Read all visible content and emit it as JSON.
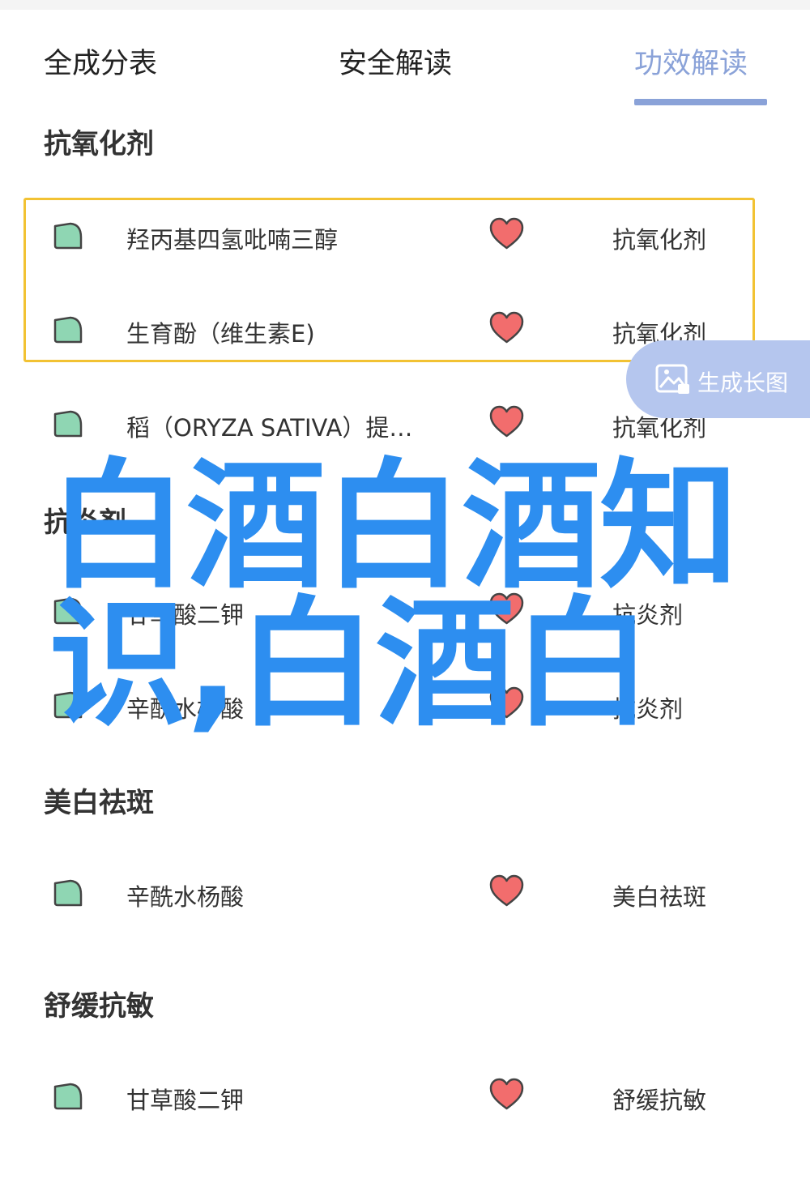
{
  "tabs": {
    "items": [
      "全成分表",
      "安全解读",
      "功效解读"
    ],
    "active_index": 2,
    "accent_color": "#8aa2d8"
  },
  "sections": [
    {
      "title": "抗氧化剂",
      "rows": [
        {
          "icon": "ingredient-leaf-icon",
          "name": "羟丙基四氢吡喃三醇",
          "rating_icon": "heart-icon",
          "effect": "抗氧化剂"
        },
        {
          "icon": "ingredient-leaf-icon",
          "name": "生育酚（维生素E)",
          "rating_icon": "heart-icon",
          "effect": "抗氧化剂"
        },
        {
          "icon": "ingredient-leaf-icon",
          "name": "稻（ORYZA SATIVA）提…",
          "rating_icon": "heart-icon",
          "effect": "抗氧化剂"
        }
      ]
    },
    {
      "title": "抗炎剂",
      "rows": [
        {
          "icon": "ingredient-leaf-icon",
          "name": "甘草酸二钾",
          "rating_icon": "heart-icon",
          "effect": "抗炎剂"
        },
        {
          "icon": "ingredient-leaf-icon",
          "name": "辛酰水杨酸",
          "rating_icon": "heart-icon",
          "effect": "抗炎剂"
        }
      ]
    },
    {
      "title": "美白祛斑",
      "rows": [
        {
          "icon": "ingredient-leaf-icon",
          "name": "辛酰水杨酸",
          "rating_icon": "heart-icon",
          "effect": "美白祛斑"
        }
      ]
    },
    {
      "title": "舒缓抗敏",
      "rows": [
        {
          "icon": "ingredient-leaf-icon",
          "name": "甘草酸二钾",
          "rating_icon": "heart-icon",
          "effect": "舒缓抗敏"
        }
      ]
    }
  ],
  "floating_button": {
    "label": "生成长图",
    "icon": "chart-image-icon"
  },
  "watermark": {
    "text": "白酒白酒知识,白酒白",
    "color": "#2d8ef0"
  },
  "colors": {
    "heart": "#f26d6d",
    "leaf": "#8fd6b3",
    "highlight_border": "#f2c233"
  }
}
